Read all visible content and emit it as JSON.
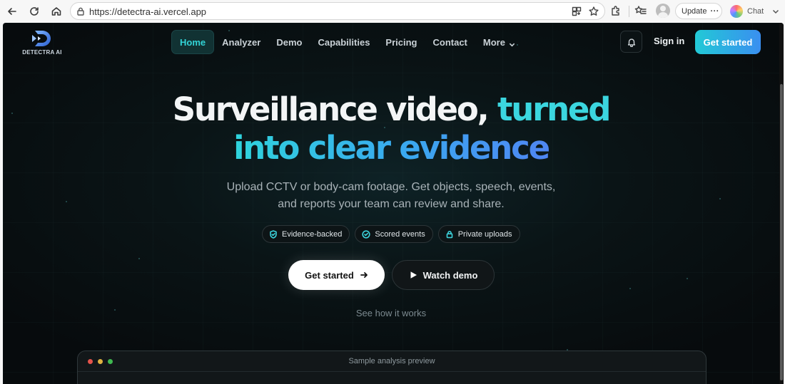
{
  "browser": {
    "url": "https://detectra-ai.vercel.app",
    "update_label": "Update",
    "chat_label": "Chat"
  },
  "site": {
    "logo_text": "DETECTRA AI",
    "nav": [
      {
        "label": "Home",
        "active": true
      },
      {
        "label": "Analyzer"
      },
      {
        "label": "Demo"
      },
      {
        "label": "Capabilities"
      },
      {
        "label": "Pricing"
      },
      {
        "label": "Contact"
      },
      {
        "label": "More"
      }
    ],
    "signin_label": "Sign in",
    "cta_label": "Get started"
  },
  "hero": {
    "headline_white": "Surveillance video, ",
    "headline_accent": "turned",
    "headline_line2": "into clear evidence",
    "subtitle_line1": "Upload CCTV or body-cam footage. Get objects, speech, events,",
    "subtitle_line2": "and reports your team can review and share.",
    "badges": [
      {
        "label": "Evidence-backed",
        "icon": "shield-check-icon"
      },
      {
        "label": "Scored events",
        "icon": "check-circle-icon"
      },
      {
        "label": "Private uploads",
        "icon": "lock-icon"
      }
    ],
    "primary_button": "Get started",
    "secondary_button": "Watch demo",
    "see_how": "See how it works"
  },
  "preview": {
    "title": "Sample analysis preview"
  },
  "colors": {
    "accent": "#3bd6df",
    "accent_blue": "#4f86f2",
    "background": "#070b0d"
  }
}
